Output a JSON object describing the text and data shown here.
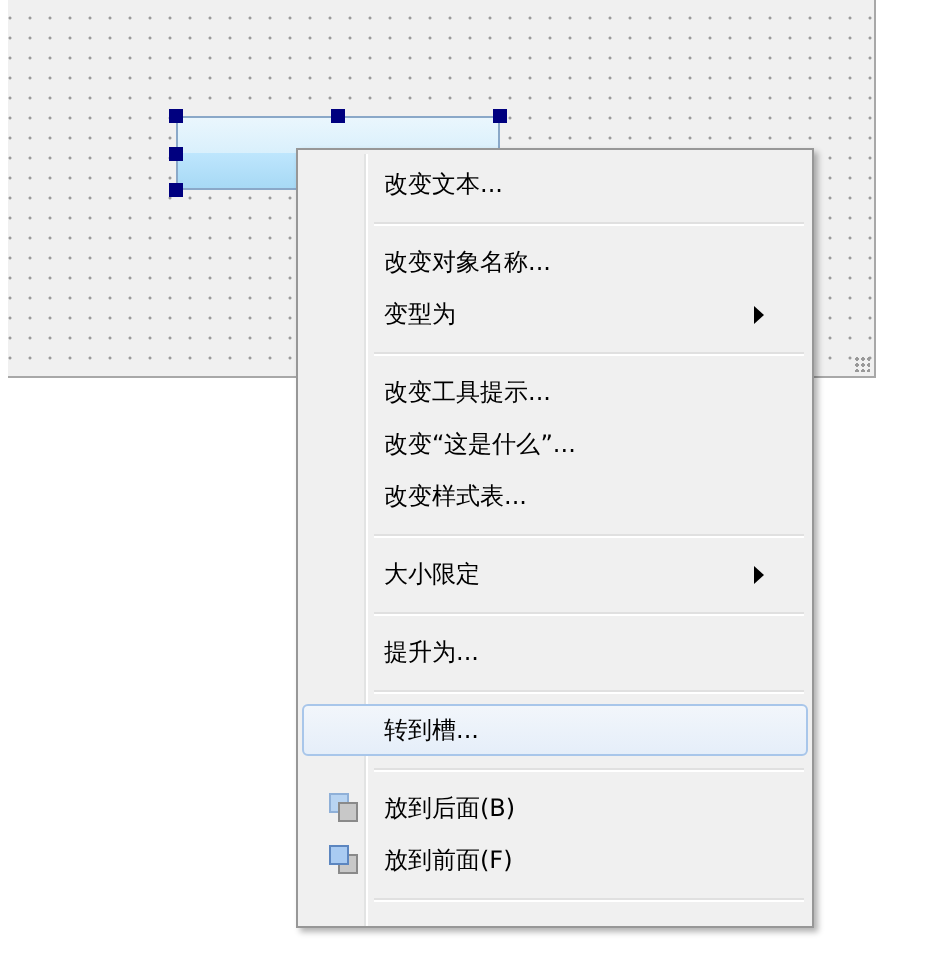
{
  "form": {
    "button": {
      "selected": true
    }
  },
  "context_menu": {
    "items": [
      {
        "kind": "action",
        "label": "改变文本...",
        "submenu": false,
        "selected": false
      },
      {
        "kind": "separator"
      },
      {
        "kind": "action",
        "label": "改变对象名称...",
        "submenu": false,
        "selected": false
      },
      {
        "kind": "action",
        "label": "变型为",
        "submenu": true,
        "selected": false
      },
      {
        "kind": "separator"
      },
      {
        "kind": "action",
        "label": "改变工具提示...",
        "submenu": false,
        "selected": false
      },
      {
        "kind": "action",
        "label": "改变“这是什么”...",
        "submenu": false,
        "selected": false
      },
      {
        "kind": "action",
        "label": "改变样式表...",
        "submenu": false,
        "selected": false
      },
      {
        "kind": "separator"
      },
      {
        "kind": "action",
        "label": "大小限定",
        "submenu": true,
        "selected": false
      },
      {
        "kind": "separator"
      },
      {
        "kind": "action",
        "label": "提升为...",
        "submenu": false,
        "selected": false
      },
      {
        "kind": "separator"
      },
      {
        "kind": "action",
        "label": "转到槽...",
        "submenu": false,
        "selected": true
      },
      {
        "kind": "separator"
      },
      {
        "kind": "sendback",
        "label": "放到后面(B)",
        "submenu": false,
        "selected": false
      },
      {
        "kind": "bringfront",
        "label": "放到前面(F)",
        "submenu": false,
        "selected": false
      },
      {
        "kind": "separator"
      }
    ]
  }
}
